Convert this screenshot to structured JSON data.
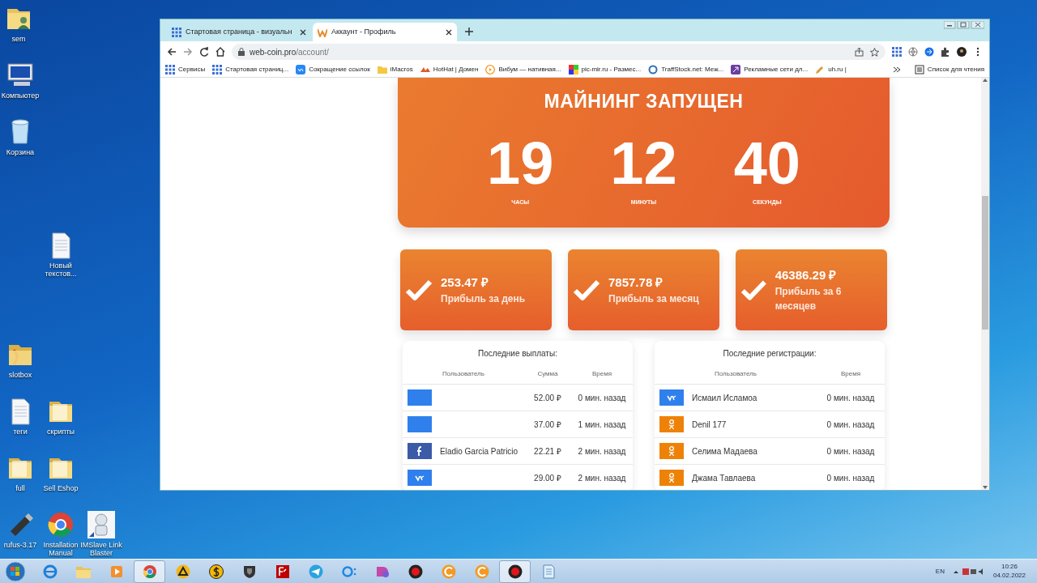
{
  "desktop": {
    "icons": [
      {
        "label": "sem",
        "kind": "user-folder"
      },
      {
        "label": "Компьютер",
        "kind": "computer"
      },
      {
        "label": "Корзина",
        "kind": "bin"
      },
      {
        "label": "Новый текстов...",
        "kind": "document"
      },
      {
        "label": "slotbox",
        "kind": "color-folder"
      },
      {
        "label": "теги",
        "kind": "document"
      },
      {
        "label": "скрипты",
        "kind": "folder"
      },
      {
        "label": "full",
        "kind": "folder"
      },
      {
        "label": "Sell Eshop",
        "kind": "folder"
      },
      {
        "label": "rufus-3.17",
        "kind": "usb"
      },
      {
        "label": "Installation Manual",
        "kind": "chrome"
      },
      {
        "label": "IMSlave Link Blaster",
        "kind": "robot"
      }
    ]
  },
  "browser": {
    "tabs": [
      {
        "title": "Стартовая страница - визуальн",
        "kind": "grid",
        "selected": false
      },
      {
        "title": "Аккаунт - Профиль",
        "kind": "w",
        "selected": true
      }
    ],
    "address": {
      "host": "web-coin.pro",
      "path": "/account/"
    },
    "bookmarks": [
      {
        "label": "Сервисы",
        "kind": "apps"
      },
      {
        "label": "Стартовая страниц...",
        "kind": "grid"
      },
      {
        "label": "Сокращение ссылок",
        "kind": "vk"
      },
      {
        "label": "iMacros",
        "kind": "folder"
      },
      {
        "label": "HotHat | Домен",
        "kind": "hat"
      },
      {
        "label": "Вибум — нативная...",
        "kind": "play"
      },
      {
        "label": "pic-mir.ru - Размес...",
        "kind": "rainbow"
      },
      {
        "label": "TraffStock.net: Меж...",
        "kind": "ring"
      },
      {
        "label": "Рекламные сети дл...",
        "kind": "purple"
      },
      {
        "label": "uh.ru |",
        "kind": "pencil"
      }
    ],
    "reading_list": "Список для чтения"
  },
  "page": {
    "mining": {
      "title": "МАЙНИНГ ЗАПУЩЕН",
      "counters": [
        {
          "value": "19",
          "label": "ЧАСЫ"
        },
        {
          "value": "12",
          "label": "МИНУТЫ"
        },
        {
          "value": "40",
          "label": "СЕКУНДЫ"
        }
      ]
    },
    "stats": [
      {
        "amount": "253.47 ₽",
        "label": "Прибыль за день"
      },
      {
        "amount": "7857.78 ₽",
        "label": "Прибыль за месяц"
      },
      {
        "amount": "46386.29 ₽",
        "label": "Прибыль за 6 месяцев"
      }
    ],
    "payouts": {
      "title": "Последние выплаты:",
      "columns": [
        "Пользователь",
        "Сумма",
        "Время"
      ],
      "rows": [
        {
          "kind": "blank",
          "user": "",
          "amount": "52.00 ₽",
          "time": "0 мин. назад"
        },
        {
          "kind": "blank",
          "user": "",
          "amount": "37.00 ₽",
          "time": "1 мин. назад"
        },
        {
          "kind": "fb",
          "user": "Eladio Garcia Patricio",
          "amount": "22.21 ₽",
          "time": "2 мин. назад"
        },
        {
          "kind": "vk",
          "user": "",
          "amount": "29.00 ₽",
          "time": "2 мин. назад"
        }
      ]
    },
    "registrations": {
      "title": "Последние регистрации:",
      "columns": [
        "Пользователь",
        "Время"
      ],
      "rows": [
        {
          "kind": "vk",
          "user": "Исмаил Исламоа",
          "time": "0 мин. назад"
        },
        {
          "kind": "ok",
          "user": "Denil 177",
          "time": "0 мин. назад"
        },
        {
          "kind": "ok",
          "user": "Селима Мадаева",
          "time": "0 мин. назад"
        },
        {
          "kind": "ok",
          "user": "Джама Тавлаева",
          "time": "0 мин. назад"
        }
      ]
    }
  },
  "taskbar": {
    "apps": [
      {
        "kind": "ie",
        "selected": false
      },
      {
        "kind": "explorer",
        "selected": false
      },
      {
        "kind": "media",
        "selected": false
      },
      {
        "kind": "chrome",
        "selected": true
      },
      {
        "kind": "triangle",
        "selected": false
      },
      {
        "kind": "coin",
        "selected": false
      },
      {
        "kind": "shield",
        "selected": false
      },
      {
        "kind": "filezilla",
        "selected": false
      },
      {
        "kind": "telegram",
        "selected": false
      },
      {
        "kind": "dots",
        "selected": false
      },
      {
        "kind": "pink",
        "selected": false
      },
      {
        "kind": "record",
        "selected": false
      },
      {
        "kind": "copper",
        "selected": false
      },
      {
        "kind": "copper",
        "selected": false
      },
      {
        "kind": "record",
        "selected": true
      },
      {
        "kind": "notepad",
        "selected": false
      }
    ],
    "language": "EN",
    "time": "10:26",
    "date": "04.02.2022"
  }
}
